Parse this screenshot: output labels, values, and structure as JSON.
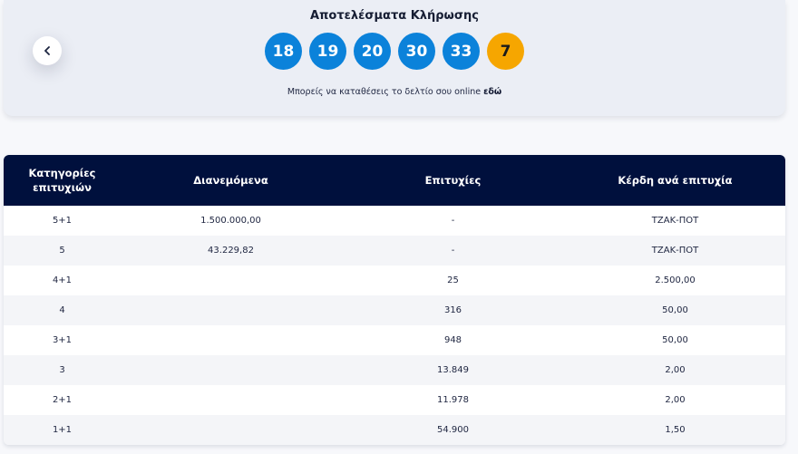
{
  "header": {
    "title": "Αποτελέσματα Κλήρωσης",
    "numbers": [
      "18",
      "19",
      "20",
      "30",
      "33"
    ],
    "bonus": "7",
    "note_text": "Μπορείς να καταθέσεις το δελτίο σου online ",
    "note_link": "εδώ",
    "colors": {
      "ball": "#0b82da",
      "bonus": "#f6a600",
      "table_header": "#00103d"
    }
  },
  "table": {
    "headers": [
      "Κατηγορίες επιτυχιών",
      "Διανεμόμενα",
      "Επιτυχίες",
      "Κέρδη ανά επιτυχία"
    ],
    "rows": [
      [
        "5+1",
        "1.500.000,00",
        "-",
        "ΤΖΑΚ-ΠΟΤ"
      ],
      [
        "5",
        "43.229,82",
        "-",
        "ΤΖΑΚ-ΠΟΤ"
      ],
      [
        "4+1",
        "",
        "25",
        "2.500,00"
      ],
      [
        "4",
        "",
        "316",
        "50,00"
      ],
      [
        "3+1",
        "",
        "948",
        "50,00"
      ],
      [
        "3",
        "",
        "13.849",
        "2,00"
      ],
      [
        "2+1",
        "",
        "11.978",
        "2,00"
      ],
      [
        "1+1",
        "",
        "54.900",
        "1,50"
      ]
    ]
  }
}
